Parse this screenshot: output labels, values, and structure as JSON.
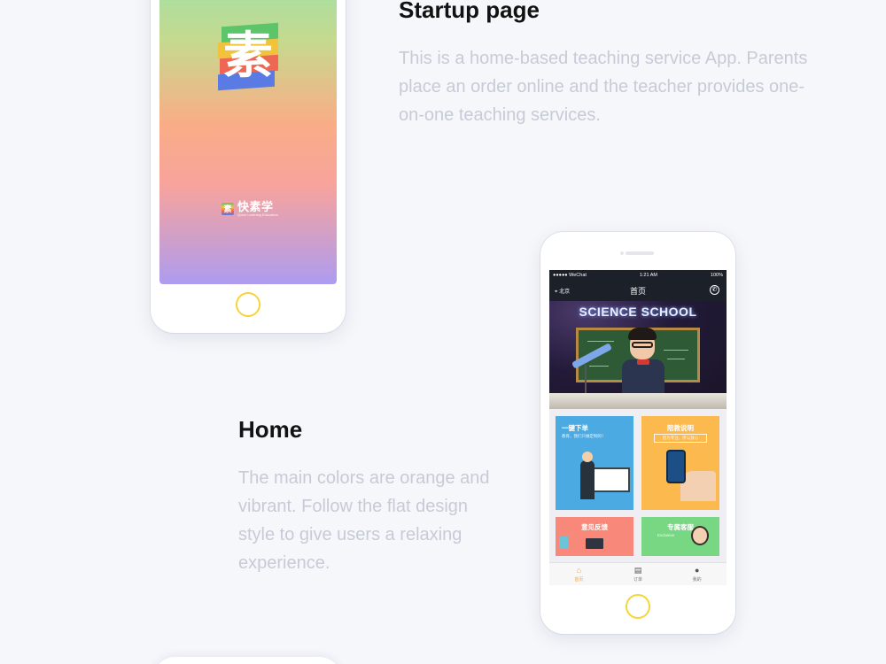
{
  "startup": {
    "title": "Startup page",
    "description": "This is a home-based teaching service App. Parents place an order online and the teacher provides one-on-one teaching services.",
    "logo_char": "素",
    "brand_name": "快素学",
    "brand_sub": "Quick Learning Education",
    "colors": {
      "green": "#5cc56a",
      "yellow": "#f1c33c",
      "red": "#ef6752",
      "blue": "#5b7be4"
    }
  },
  "home": {
    "title": "Home",
    "description": "The main colors are orange and vibrant. Follow the flat design style to give users a relaxing experience.",
    "status": {
      "carrier": "●●●●● WeChat",
      "time": "1:21 AM",
      "battery": "100%"
    },
    "nav": {
      "location": "北京",
      "title": "首页"
    },
    "banner_title": "SCIENCE SCHOOL",
    "cards": {
      "order": {
        "title": "一键下单",
        "subtitle": "教育，我们只做定制的！"
      },
      "guide": {
        "title": "陪教说明",
        "subtitle": "因为专注，所以放心"
      },
      "feedback": {
        "title": "意见反馈"
      },
      "service": {
        "title": "专属客服",
        "subtitle": "Exclusive"
      }
    },
    "tabs": [
      {
        "label": "首页",
        "icon": "home-icon"
      },
      {
        "label": "订单",
        "icon": "order-icon"
      },
      {
        "label": "我的",
        "icon": "profile-icon"
      }
    ],
    "accent": "#f5a442"
  }
}
